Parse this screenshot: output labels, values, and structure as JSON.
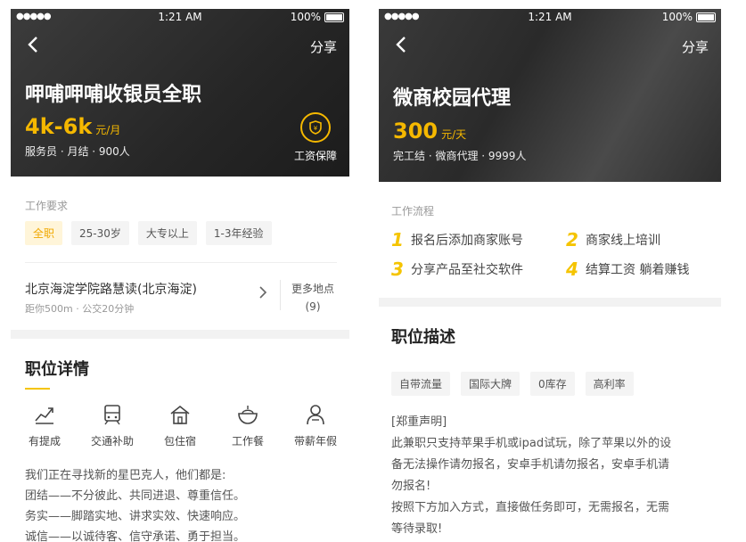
{
  "status": {
    "time": "1:21 AM",
    "battery": "100%",
    "signal": "●●●●●"
  },
  "share_label": "分享",
  "left": {
    "title": "呷哺呷哺收银员全职",
    "salary": "4k-6k",
    "salary_unit": "元/月",
    "meta": "服务员 · 月结 · 900人",
    "guarantee": "工资保障",
    "req_label": "工作要求",
    "tags": [
      "全职",
      "25-30岁",
      "大专以上",
      "1-3年经验"
    ],
    "location": {
      "title": "北京海淀学院路慧读(北京海淀)",
      "sub": "距你500m · 公交20分钟",
      "more": "更多地点",
      "count": "(9)"
    },
    "details_heading": "职位详情",
    "benefits": [
      {
        "icon": "chart-icon",
        "label": "有提成"
      },
      {
        "icon": "train-icon",
        "label": "交通补助"
      },
      {
        "icon": "house-icon",
        "label": "包住宿"
      },
      {
        "icon": "bowl-icon",
        "label": "工作餐"
      },
      {
        "icon": "person-icon",
        "label": "带薪年假"
      }
    ],
    "description": [
      "我们正在寻找新的星巴克人，他们都是:",
      "团结——不分彼此、共同进退、尊重信任。",
      "务实——脚踏实地、讲求实效、快速响应。",
      "诚信——以诚待客、信守承诺、勇于担当。"
    ]
  },
  "right": {
    "title": "微商校园代理",
    "salary": "300",
    "salary_unit": "元/天",
    "meta": "完工结 · 微商代理 · 9999人",
    "flow_label": "工作流程",
    "flow": [
      {
        "num": "1",
        "text": "报名后添加商家账号"
      },
      {
        "num": "2",
        "text": "商家线上培训"
      },
      {
        "num": "3",
        "text": "分享产品至社交软件"
      },
      {
        "num": "4",
        "text": "结算工资 躺着赚钱"
      }
    ],
    "desc_heading": "职位描述",
    "tags": [
      "自带流量",
      "国际大牌",
      "0库存",
      "高利率"
    ],
    "statement": [
      "[郑重声明]",
      "此兼职只支持苹果手机或ipad试玩，除了苹果以外的设",
      "备无法操作请勿报名，安卓手机请勿报名，安卓手机请",
      "勿报名!",
      "按照下方加入方式，直接做任务即可，无需报名，无需",
      "等待录取!"
    ]
  },
  "colors": {
    "accent": "#f5b800",
    "hero_bg": "#2a2a2a"
  }
}
